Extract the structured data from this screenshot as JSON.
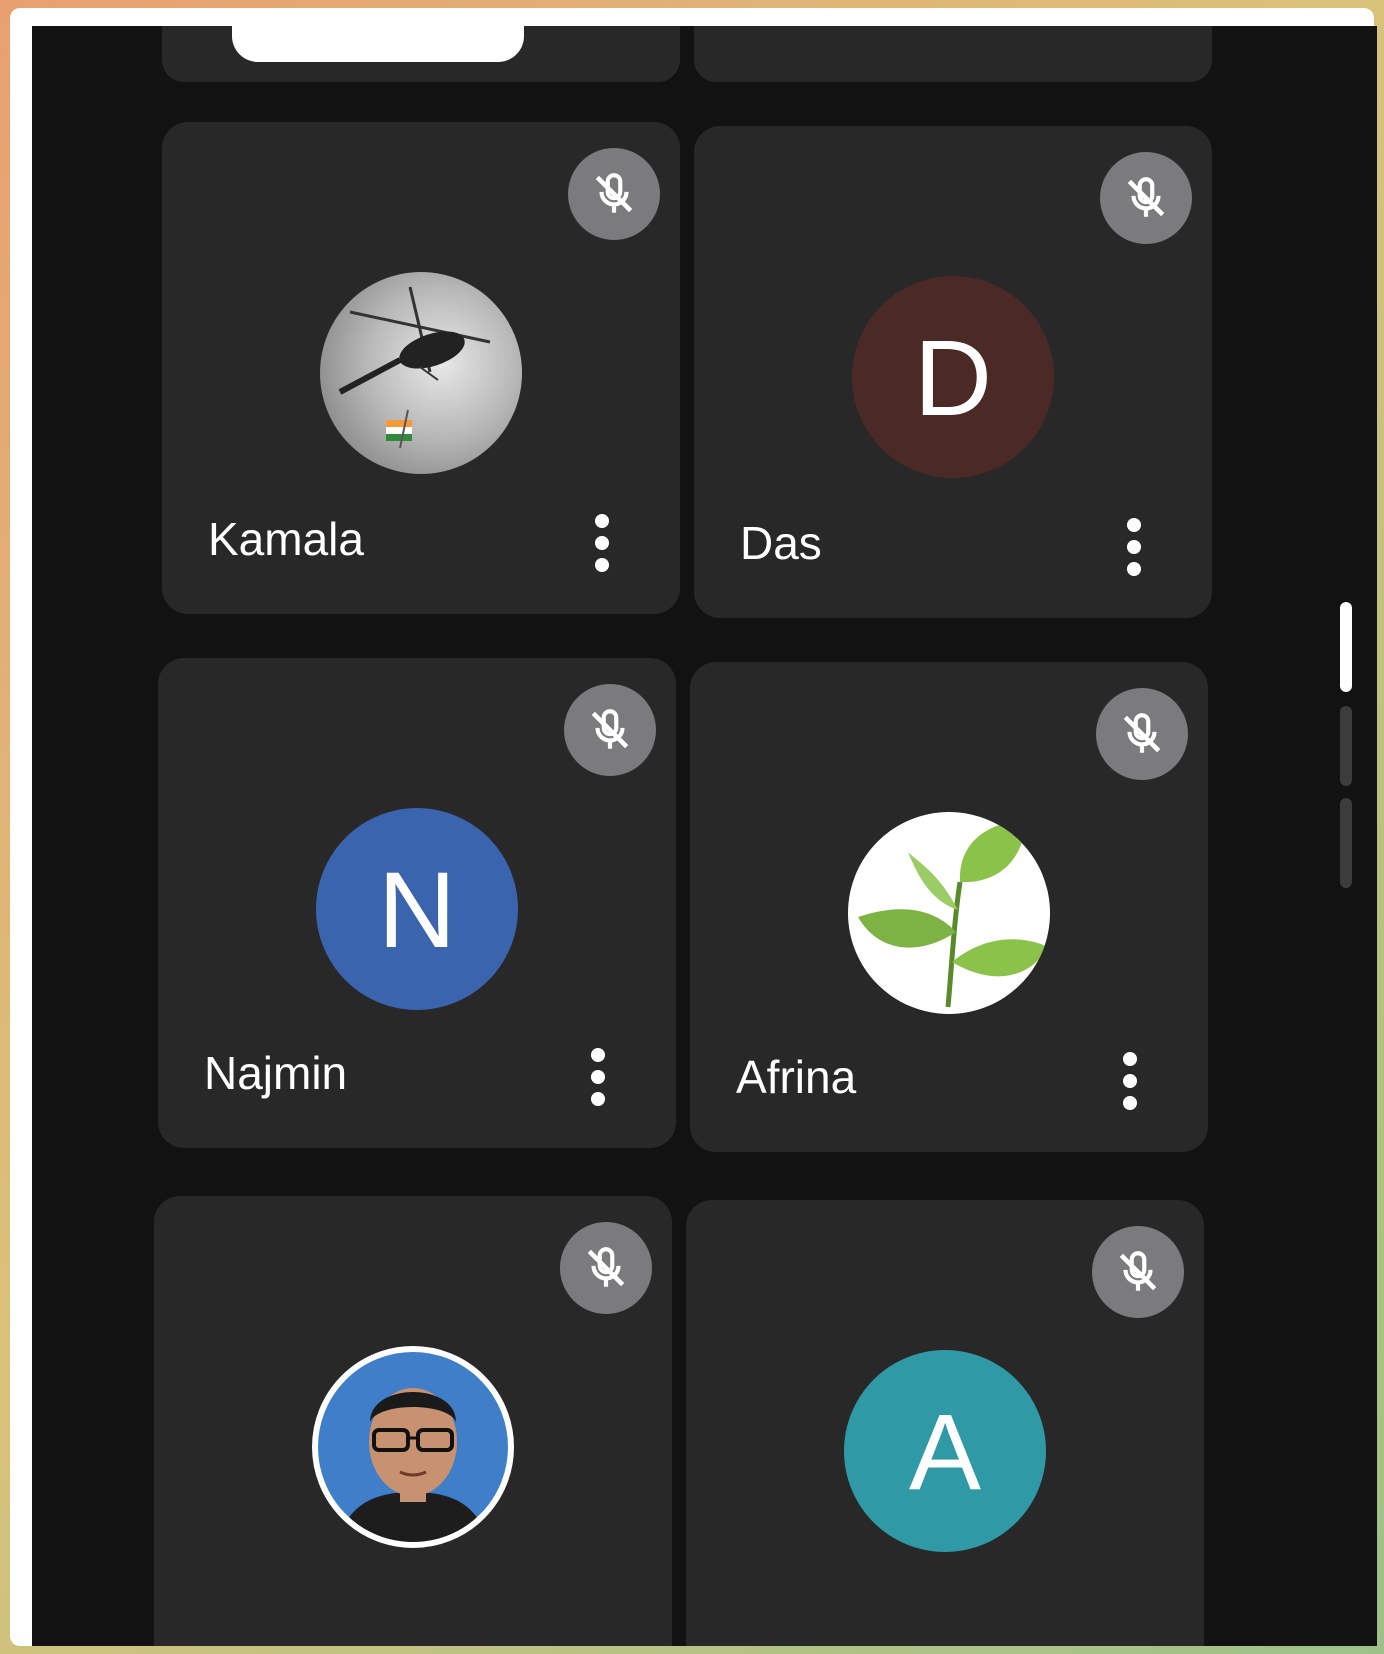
{
  "participants": [
    {
      "name": "Kamala",
      "avatar_type": "photo",
      "avatar_icon": "helicopter-flag-photo",
      "muted": true
    },
    {
      "name": "Das",
      "avatar_type": "initial",
      "initial": "D",
      "avatar_color": "#4b2a25",
      "muted": true
    },
    {
      "name": "Najmin",
      "avatar_type": "initial",
      "initial": "N",
      "avatar_color": "#3a64ad",
      "muted": true
    },
    {
      "name": "Afrina",
      "avatar_type": "photo",
      "avatar_icon": "green-leaves-photo",
      "muted": true
    },
    {
      "name": "",
      "avatar_type": "photo",
      "avatar_icon": "man-with-glasses-photo",
      "muted": true
    },
    {
      "name": "",
      "avatar_type": "initial",
      "initial": "A",
      "avatar_color": "#2f9aa6",
      "muted": true
    }
  ],
  "colors": {
    "background": "#121212",
    "tile": "#282828",
    "mic_badge": "#7b7b7e",
    "text": "#ffffff"
  }
}
